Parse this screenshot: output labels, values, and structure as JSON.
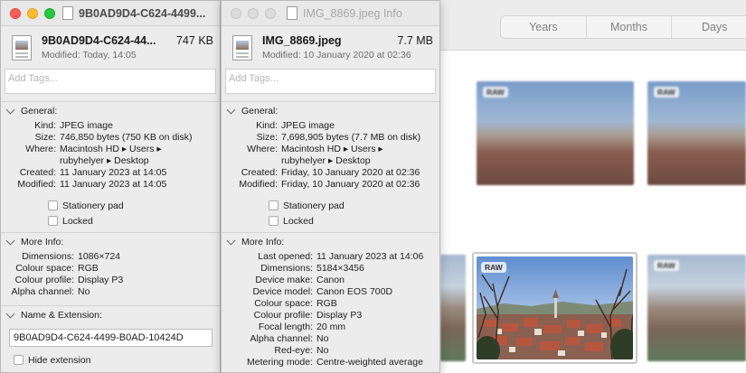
{
  "photos": {
    "tabs": [
      "Years",
      "Months",
      "Days"
    ],
    "raw_badge": "RAW"
  },
  "window1": {
    "title": "9B0AD9D4-C624-4499...",
    "file_name": "9B0AD9D4-C624-44...",
    "file_size": "747 KB",
    "modified_line": "Modified: Today, 14:05",
    "tags_placeholder": "Add Tags...",
    "general_label": "General:",
    "general": [
      {
        "k": "Kind:",
        "v": "JPEG image"
      },
      {
        "k": "Size:",
        "v": "746,850 bytes (750 KB on disk)"
      },
      {
        "k": "Where:",
        "v": "Macintosh HD ▸ Users ▸"
      },
      {
        "k": "",
        "v": "rubyhelyer ▸ Desktop"
      },
      {
        "k": "Created:",
        "v": "11 January 2023 at 14:05"
      },
      {
        "k": "Modified:",
        "v": "11 January 2023 at 14:05"
      }
    ],
    "stationery": "Stationery pad",
    "locked": "Locked",
    "more_label": "More Info:",
    "more": [
      {
        "k": "Dimensions:",
        "v": "1086×724"
      },
      {
        "k": "Colour space:",
        "v": "RGB"
      },
      {
        "k": "Colour profile:",
        "v": "Display P3"
      },
      {
        "k": "Alpha channel:",
        "v": "No"
      }
    ],
    "name_ext_label": "Name & Extension:",
    "name_ext_value": "9B0AD9D4-C624-4499-B0AD-10424D",
    "hide_ext": "Hide extension"
  },
  "window2": {
    "title": "IMG_8869.jpeg Info",
    "file_name": "IMG_8869.jpeg",
    "file_size": "7.7 MB",
    "modified_line": "Modified: 10 January 2020 at 02:36",
    "tags_placeholder": "Add Tags...",
    "general_label": "General:",
    "general": [
      {
        "k": "Kind:",
        "v": "JPEG image"
      },
      {
        "k": "Size:",
        "v": "7,698,905 bytes (7.7 MB on disk)"
      },
      {
        "k": "Where:",
        "v": "Macintosh HD ▸ Users ▸"
      },
      {
        "k": "",
        "v": "rubyhelyer ▸ Desktop"
      },
      {
        "k": "Created:",
        "v": "Friday, 10 January 2020 at 02:36"
      },
      {
        "k": "Modified:",
        "v": "Friday, 10 January 2020 at 02:36"
      }
    ],
    "stationery": "Stationery pad",
    "locked": "Locked",
    "more_label": "More Info:",
    "more": [
      {
        "k": "Last opened:",
        "v": "11 January 2023 at 14:06"
      },
      {
        "k": "Dimensions:",
        "v": "5184×3456"
      },
      {
        "k": "Device make:",
        "v": "Canon"
      },
      {
        "k": "Device model:",
        "v": "Canon EOS 700D"
      },
      {
        "k": "Colour space:",
        "v": "RGB"
      },
      {
        "k": "Colour profile:",
        "v": "Display P3"
      },
      {
        "k": "Focal length:",
        "v": "20 mm"
      },
      {
        "k": "Alpha channel:",
        "v": "No"
      },
      {
        "k": "Red-eye:",
        "v": "No"
      },
      {
        "k": "Metering mode:",
        "v": "Centre-weighted average"
      }
    ]
  }
}
